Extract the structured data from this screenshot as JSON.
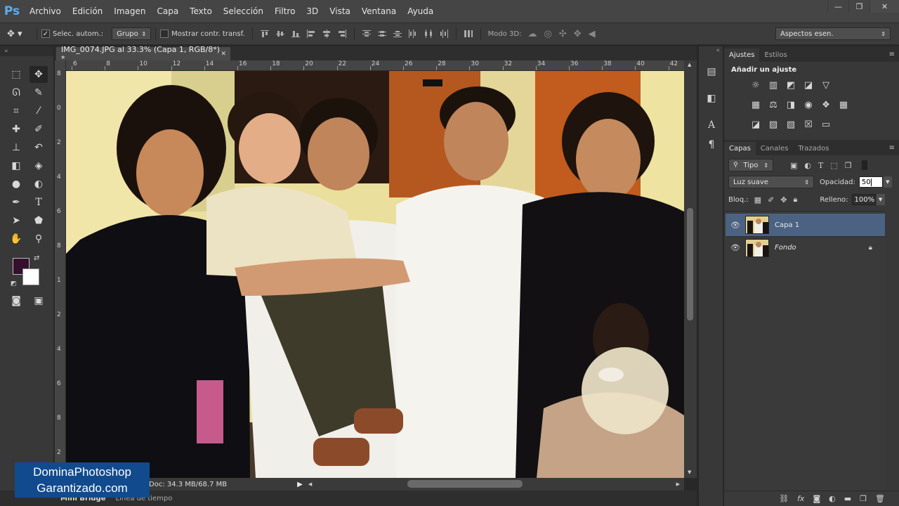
{
  "app": {
    "logo": "Ps"
  },
  "menu": [
    "Archivo",
    "Edición",
    "Imagen",
    "Capa",
    "Texto",
    "Selección",
    "Filtro",
    "3D",
    "Vista",
    "Ventana",
    "Ayuda"
  ],
  "window_controls": {
    "minimize": "—",
    "restore": "❐",
    "close": "✕"
  },
  "options": {
    "auto_select_label": "Selec. autom.:",
    "auto_select_checked": "✓",
    "auto_select_target": "Grupo",
    "show_transform_label": "Mostrar contr. transf.",
    "mode3d_label": "Modo 3D:",
    "workspace": "Aspectos esen."
  },
  "document": {
    "tab_title": "IMG_0074.JPG al 33.3% (Capa 1, RGB/8*) *",
    "tab_close": "✕",
    "status": "Doc: 34.3 MB/68.7 MB",
    "ruler_top": [
      "6",
      "8",
      "10",
      "12",
      "14",
      "16",
      "18",
      "20",
      "22",
      "24",
      "26",
      "28",
      "30",
      "32",
      "34",
      "36",
      "38",
      "40",
      "42"
    ],
    "ruler_left": [
      "8",
      "0",
      "2",
      "4",
      "6",
      "8",
      "1",
      "2",
      "4",
      "6",
      "8",
      "2"
    ]
  },
  "bottom_tabs": {
    "mini_bridge": "Mini Bridge",
    "timeline": "Línea de tiempo"
  },
  "adjustments": {
    "tabs": [
      "Ajustes",
      "Estilos"
    ],
    "heading": "Añadir un ajuste"
  },
  "layers": {
    "tabs": [
      "Capas",
      "Canales",
      "Trazados"
    ],
    "filter_kind": "Tipo",
    "blend_mode": "Luz suave",
    "opacity_label": "Opacidad:",
    "opacity_value": "50",
    "lock_label": "Bloq.:",
    "fill_label": "Relleno:",
    "fill_value": "100%",
    "items": [
      {
        "name": "Capa 1",
        "selected": true
      },
      {
        "name": "Fondo",
        "selected": false
      }
    ]
  },
  "colors": {
    "foreground": "#34102e",
    "background": "#ffffff",
    "selection": "#4b6283"
  },
  "watermark": {
    "line1": "DominaPhotoshop",
    "line2": "Garantizado.com"
  }
}
